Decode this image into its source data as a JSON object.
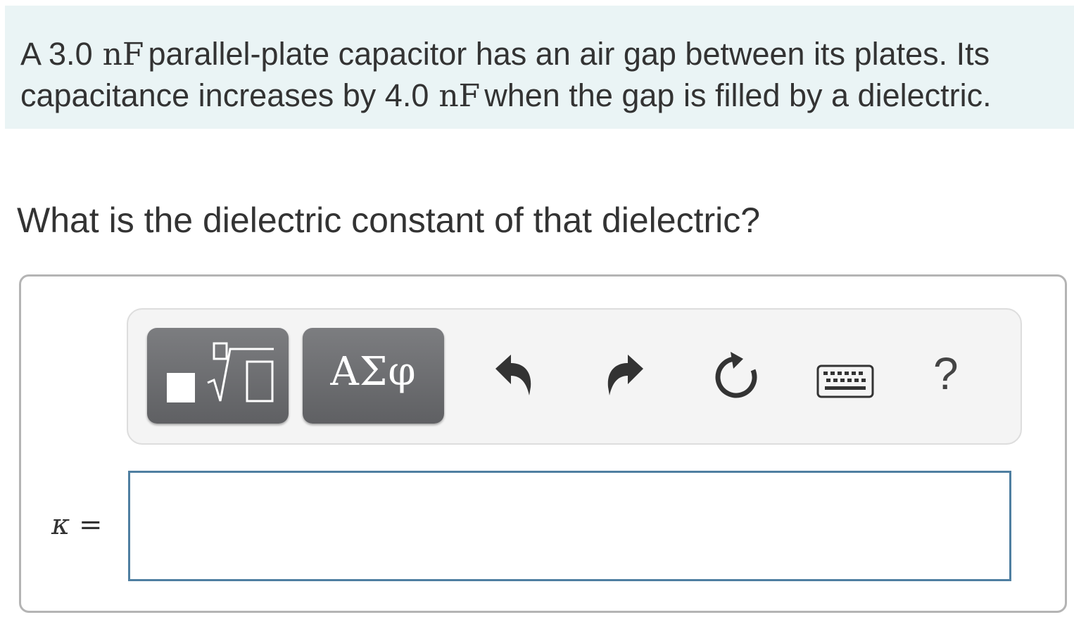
{
  "problem": {
    "line1_part1": "A 3.0",
    "line1_unit": "nF",
    "line1_part2": "parallel-plate capacitor has an air gap between its plates. Its",
    "line2_part1": "capacitance increases by 4.0",
    "line2_unit": "nF",
    "line2_part2": "when the gap is filled by a dielectric."
  },
  "question": "What is the dielectric constant of that dielectric?",
  "toolbar": {
    "templates_icon": "templates-icon",
    "symbols_label": "ΑΣφ",
    "undo_icon": "undo-icon",
    "redo_icon": "redo-icon",
    "reset_icon": "reset-icon",
    "keyboard_icon": "keyboard-icon",
    "help_label": "?"
  },
  "answer": {
    "variable": "κ",
    "equals": "=",
    "value": ""
  },
  "colors": {
    "problem_background": "#eaf4f5",
    "input_border": "#4f7fa1",
    "button_gray": "#6e6f72"
  }
}
